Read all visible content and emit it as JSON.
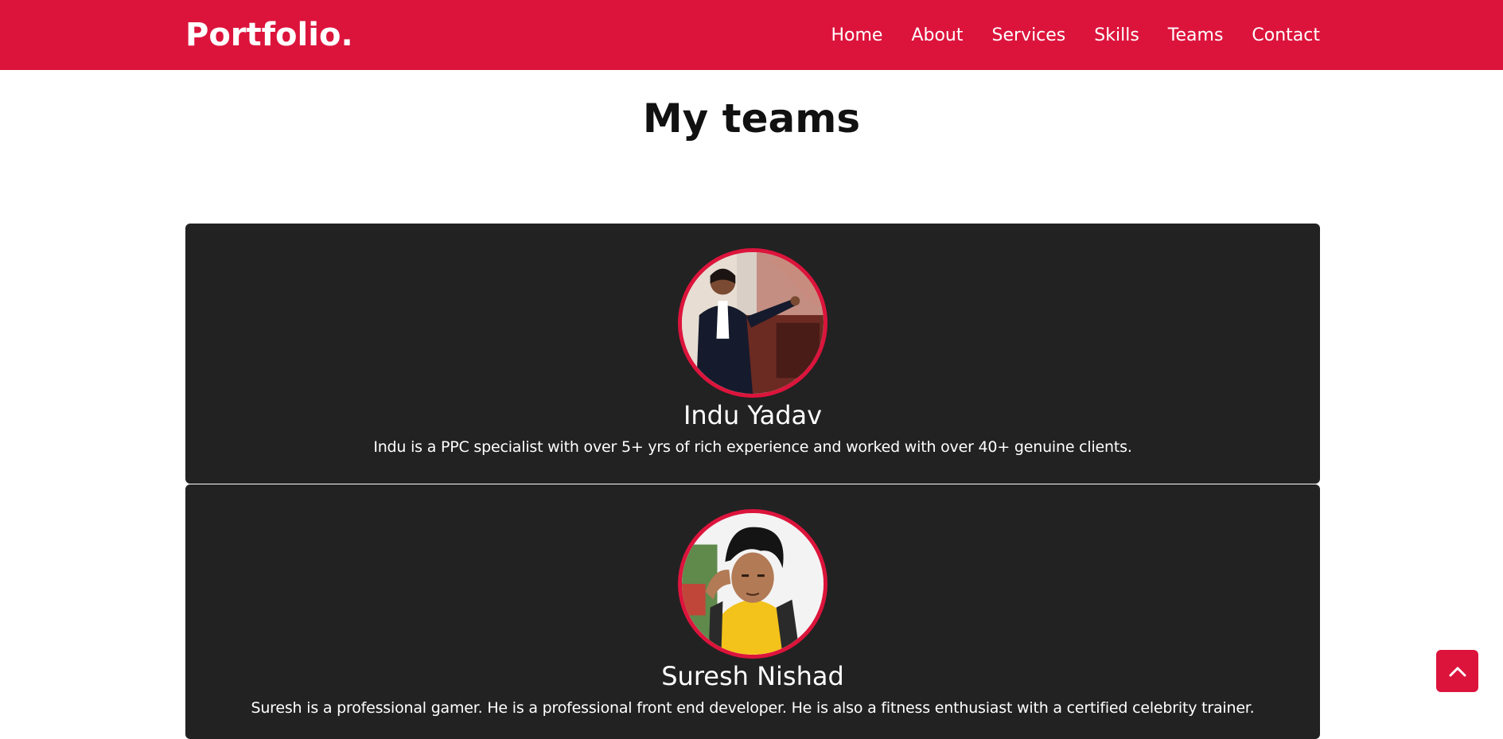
{
  "brand": {
    "logo_text": "Portfolio",
    "logo_dot": ".",
    "accent_color": "#dc143c"
  },
  "nav": {
    "items": [
      {
        "label": "Home"
      },
      {
        "label": "About"
      },
      {
        "label": "Services"
      },
      {
        "label": "Skills"
      },
      {
        "label": "Teams"
      },
      {
        "label": "Contact"
      }
    ]
  },
  "teams": {
    "title": "My teams",
    "members": [
      {
        "name": "Indu Yadav",
        "bio": "Indu is a PPC specialist with over 5+ yrs of rich experience and worked with over 40+ genuine clients."
      },
      {
        "name": "Suresh Nishad",
        "bio": "Suresh is a professional gamer. He is a professional front end developer. He is also a fitness enthusiast with a certified celebrity trainer."
      }
    ]
  },
  "scroll_top": {
    "icon": "chevron-up-icon"
  }
}
